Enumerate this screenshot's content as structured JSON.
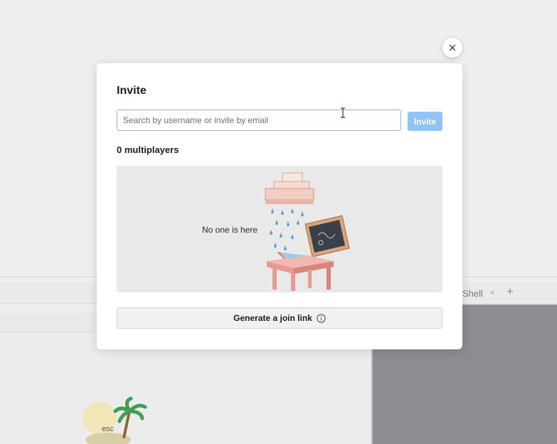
{
  "background": {
    "tabs": [
      {
        "label": "Shell",
        "close_glyph": "×"
      }
    ],
    "add_tab_glyph": "+",
    "mascot_key_label": "esc"
  },
  "modal": {
    "title": "Invite",
    "search": {
      "placeholder": "Search by username or invite by email",
      "value": ""
    },
    "invite_button_label": "Invite",
    "members_count_label": "0 multiplayers",
    "empty_state_text": "No one is here",
    "join_link_button_label": "Generate a join link",
    "close_icon": "close-icon",
    "info_icon": "info-icon"
  },
  "colors": {
    "accent_button": "#92c3f5",
    "input_border": "#9ab6d6",
    "modal_bg": "#ffffff",
    "overlay_bg": "#efefef",
    "empty_panel_bg": "#e9e9e9"
  }
}
